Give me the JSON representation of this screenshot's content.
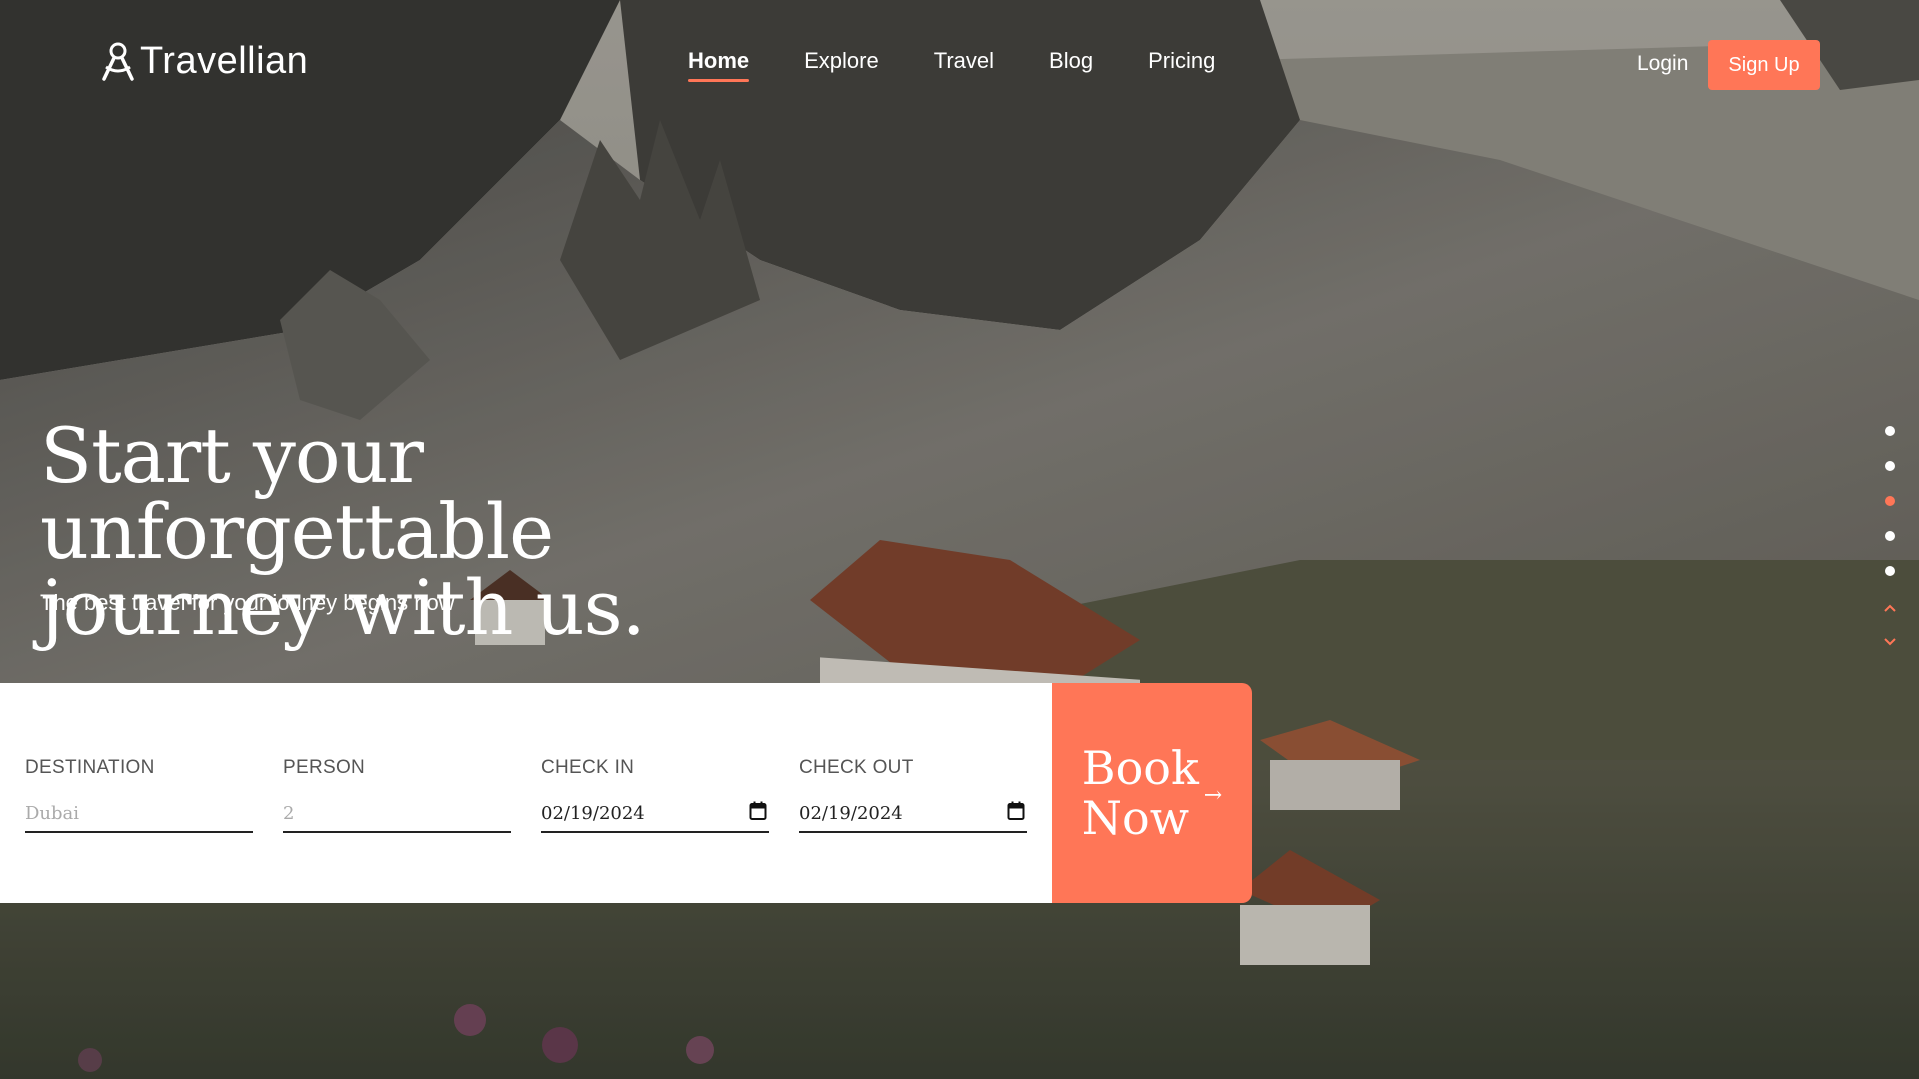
{
  "brand": {
    "name": "Travellian",
    "accent_color": "#ff7657"
  },
  "nav": {
    "items": [
      {
        "label": "Home",
        "active": true
      },
      {
        "label": "Explore",
        "active": false
      },
      {
        "label": "Travel",
        "active": false
      },
      {
        "label": "Blog",
        "active": false
      },
      {
        "label": "Pricing",
        "active": false
      }
    ],
    "login_label": "Login",
    "signup_label": "Sign Up"
  },
  "hero": {
    "title_line1": "Start your unforgettable",
    "title_line2": "journey with us.",
    "subtitle": "The best travel for your jouney begins now"
  },
  "side_nav": {
    "dot_count": 5,
    "active_dot": 3
  },
  "booking": {
    "destination": {
      "label": "DESTINATION",
      "placeholder": "Dubai",
      "value": ""
    },
    "person": {
      "label": "PERSON",
      "placeholder": "2",
      "value": ""
    },
    "check_in": {
      "label": "CHECK IN",
      "value": "02/19/2024"
    },
    "check_out": {
      "label": "CHECK OUT",
      "value": "02/19/2024"
    },
    "book_label_line1": "Book",
    "book_label_line2": "Now",
    "book_arrow": "→"
  },
  "icons": {
    "logo": "traveller-icon",
    "calendar": "calendar-icon",
    "arrow": "arrow-right-icon",
    "up": "chevron-up-icon",
    "down": "chevron-down-icon"
  }
}
